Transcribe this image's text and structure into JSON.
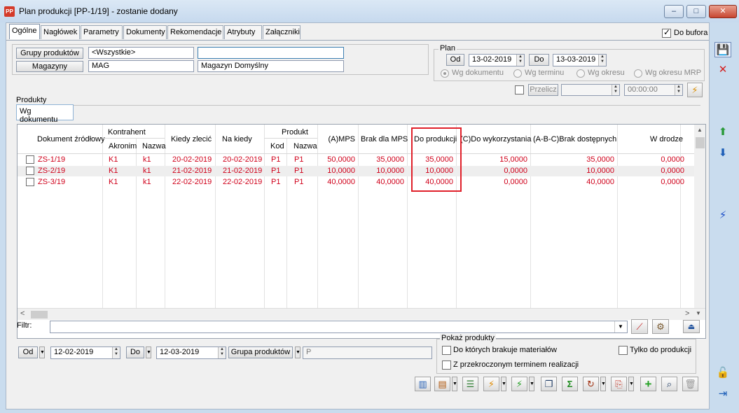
{
  "window": {
    "title": "Plan produkcji [PP-1/19] - zostanie dodany",
    "app_icon": "PP",
    "minimize": "–",
    "maximize": "□",
    "close": "✕"
  },
  "tabs": [
    "Ogólne",
    "Nagłówek",
    "Parametry",
    "Dokumenty",
    "Rekomendacje",
    "Atrybuty",
    "Załączniki"
  ],
  "do_bufora": "Do bufora",
  "filters": {
    "grupy_btn": "Grupy produktów",
    "grupy_value": "<Wszystkie>",
    "grupy_value2": "",
    "magazyny_btn": "Magazyny",
    "magazyn_code": "MAG",
    "magazyn_name": "Magazyn Domyślny"
  },
  "plan": {
    "label": "Plan",
    "od_btn": "Od",
    "od_date": "13-02-2019",
    "do_btn": "Do",
    "do_date": "13-03-2019",
    "radios": [
      "Wg dokumentu",
      "Wg terminu",
      "Wg okresu",
      "Wg okresu MRP"
    ],
    "przelicz_btn": "Przelicz",
    "przelicz_value": "",
    "time": "00:00:00"
  },
  "produkty": {
    "label": "Produkty",
    "tab": "Wg dokumentu"
  },
  "grid": {
    "headers": {
      "dokument": "Dokument źródłowy",
      "kontrahent": "Kontrahent",
      "akronim": "Akronim",
      "nazwa": "Nazwa",
      "kiedy_zlecic": "Kiedy zlecić",
      "na_kiedy": "Na kiedy",
      "produkt": "Produkt",
      "kod": "Kod",
      "pnazwa": "Nazwa",
      "mps": "(A)MPS",
      "brak_mps": "Brak dla MPS",
      "do_produkcji": "Do produkcji",
      "do_wykorzystania": "(C)Do wykorzystania",
      "brak_dostepnych": "(A-B-C)Brak dostępnych",
      "w_drodze": "W drodze"
    },
    "rows": [
      {
        "dok": "ZS-1/19",
        "akronim": "K1",
        "nazwa": "k1",
        "kiedy": "20-02-2019",
        "nakiedy": "20-02-2019",
        "kod": "P1",
        "pnazwa": "P1",
        "mps": "50,0000",
        "brak": "35,0000",
        "dopr": "35,0000",
        "dowyk": "15,0000",
        "brakdost": "35,0000",
        "wdrodze": "0,0000"
      },
      {
        "dok": "ZS-2/19",
        "akronim": "K1",
        "nazwa": "k1",
        "kiedy": "21-02-2019",
        "nakiedy": "21-02-2019",
        "kod": "P1",
        "pnazwa": "P1",
        "mps": "10,0000",
        "brak": "10,0000",
        "dopr": "10,0000",
        "dowyk": "0,0000",
        "brakdost": "10,0000",
        "wdrodze": "0,0000"
      },
      {
        "dok": "ZS-3/19",
        "akronim": "K1",
        "nazwa": "k1",
        "kiedy": "22-02-2019",
        "nakiedy": "22-02-2019",
        "kod": "P1",
        "pnazwa": "P1",
        "mps": "40,0000",
        "brak": "40,0000",
        "dopr": "40,0000",
        "dowyk": "0,0000",
        "brakdost": "40,0000",
        "wdrodze": "0,0000"
      }
    ],
    "highlight_color": "#e0202a",
    "row_text_color": "#d0001a"
  },
  "filtr": {
    "label": "Filtr:",
    "value": ""
  },
  "bottom": {
    "od_btn": "Od",
    "od_date": "12-02-2019",
    "do_btn": "Do",
    "do_date": "12-03-2019",
    "grupa_btn": "Grupa produktów",
    "grupa_value": "P"
  },
  "pokaz": {
    "label": "Pokaż produkty",
    "opt1": "Do których brakuje materiałów",
    "opt2": "Tylko do produkcji",
    "opt3": "Z przekroczonym terminem realizacji"
  }
}
